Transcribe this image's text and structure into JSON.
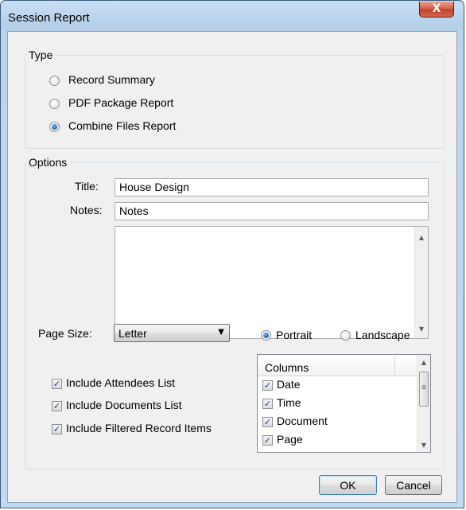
{
  "window": {
    "title": "Session Report",
    "close_glyph": "X"
  },
  "type_group": {
    "label": "Type",
    "options": [
      {
        "label": "Record Summary",
        "checked": false
      },
      {
        "label": "PDF Package Report",
        "checked": false
      },
      {
        "label": "Combine Files Report",
        "checked": true
      }
    ]
  },
  "options_group": {
    "label": "Options",
    "title_label": "Title:",
    "title_value": "House Design",
    "notes_label": "Notes:",
    "notes_value": "Notes",
    "notes_body": "",
    "page_size_label": "Page Size:",
    "page_size_value": "Letter",
    "orientation": [
      {
        "label": "Portrait",
        "checked": true
      },
      {
        "label": "Landscape",
        "checked": false
      }
    ],
    "checkboxes": [
      {
        "label": "Include Attendees List",
        "checked": true
      },
      {
        "label": "Include Documents List",
        "checked": true
      },
      {
        "label": "Include Filtered Record Items",
        "checked": true
      }
    ],
    "columns": {
      "header": "Columns",
      "items": [
        {
          "label": "Date",
          "checked": true
        },
        {
          "label": "Time",
          "checked": true
        },
        {
          "label": "Document",
          "checked": true
        },
        {
          "label": "Page",
          "checked": true
        }
      ]
    }
  },
  "buttons": {
    "ok": "OK",
    "cancel": "Cancel"
  },
  "glyphs": {
    "check": "✓",
    "up": "▲",
    "down": "▼",
    "grip": "≡"
  },
  "colors": {
    "accent": "#0b3f8e",
    "close": "#c2412c",
    "check": "#1c3f95"
  },
  "icons": [
    "close-icon",
    "checkmark-icon",
    "scroll-up-arrow-icon",
    "scroll-down-arrow-icon",
    "dropdown-arrow-icon",
    "scroll-grip-icon"
  ]
}
